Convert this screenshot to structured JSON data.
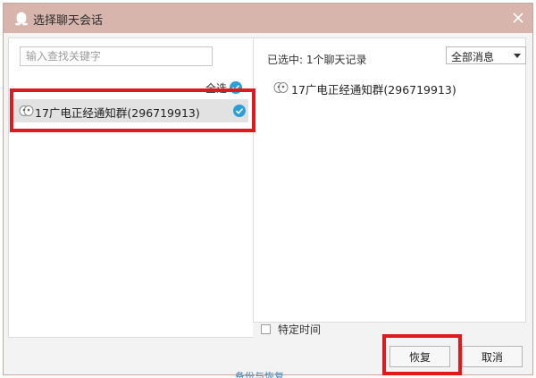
{
  "dialog": {
    "title": "选择聊天会话",
    "close_icon": "close-icon",
    "title_icon": "penguin-icon"
  },
  "left_panel": {
    "search": {
      "value": "",
      "placeholder": "输入查找关键字"
    },
    "select_all_label": "全选",
    "chats": [
      {
        "name": "17广电正经通知群(296719913)",
        "selected": true,
        "icon": "group-chat-icon"
      }
    ]
  },
  "right_panel": {
    "selected_count": "已选中: 1个聊天记录",
    "filter": {
      "selected": "全部消息"
    },
    "selected_chats": [
      {
        "name": "17广电正经通知群(296719913)",
        "icon": "group-chat-icon"
      }
    ],
    "specific_time": {
      "label": "特定时间",
      "checked": false
    }
  },
  "buttons": {
    "restore_label": "恢复",
    "cancel_label": "取消"
  },
  "background": {
    "partial_link": "备份与恢复"
  },
  "colors": {
    "titlebar": "#d7b5ad",
    "check_blue": "#2a9fd8",
    "highlight_red": "#e0191c"
  }
}
